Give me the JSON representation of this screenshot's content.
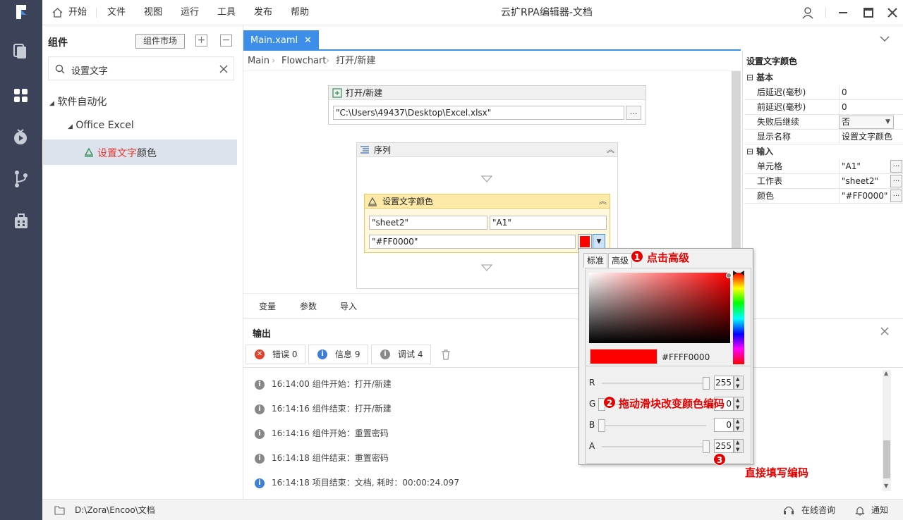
{
  "app": {
    "window_title": "云扩RPA编辑器-文档"
  },
  "menu": {
    "home": "开始",
    "file": "文件",
    "view": "视图",
    "run": "运行",
    "tools": "工具",
    "publish": "发布",
    "help": "帮助"
  },
  "left_panel": {
    "title": "组件",
    "market_button": "组件市场",
    "expand_button": "+",
    "collapse_button": "−",
    "search_value": "设置文字",
    "tree": [
      {
        "label": "软件自动化"
      },
      {
        "label": "Office Excel"
      },
      {
        "label_hit": "设置文字",
        "label_rest": "颜色"
      }
    ]
  },
  "tabs": [
    {
      "label": "Main.xaml",
      "close": "✕"
    }
  ],
  "breadcrumb": [
    "Main",
    "Flowchart",
    "打开/新建"
  ],
  "designer": {
    "open_activity": {
      "title": "打开/新建",
      "path": "\"C:\\Users\\49437\\Desktop\\Excel.xlsx\"",
      "browse": "..."
    },
    "sequence": {
      "title": "序列"
    },
    "set_color_activity": {
      "title": "设置文字颜色",
      "sheet": "\"sheet2\"",
      "cell": "\"A1\"",
      "color": "\"#FF0000\""
    }
  },
  "designer_tabs": [
    "变量",
    "参数",
    "导入"
  ],
  "properties": {
    "title": "设置文字颜色",
    "groups": [
      {
        "name": "基本",
        "rows": [
          {
            "key": "后延迟(毫秒)",
            "value": "0"
          },
          {
            "key": "前延迟(毫秒)",
            "value": "0"
          },
          {
            "key": "失败后继续",
            "value": "否"
          },
          {
            "key": "显示名称",
            "value": "设置文字颜色"
          }
        ]
      },
      {
        "name": "输入",
        "rows": [
          {
            "key": "单元格",
            "value": "\"A1\""
          },
          {
            "key": "工作表",
            "value": "\"sheet2\""
          },
          {
            "key": "颜色",
            "value": "\"#FF0000\""
          }
        ]
      }
    ]
  },
  "output": {
    "title": "输出",
    "filters": {
      "error": "错误 0",
      "info": "信息 9",
      "debug": "调试 4"
    },
    "logs": [
      {
        "text": "16:14:00 组件开始：打开/新建",
        "color": "#888888"
      },
      {
        "text": "16:14:16 组件结束：打开/新建",
        "color": "#888888"
      },
      {
        "text": "16:14:16 组件开始：重置密码",
        "color": "#888888"
      },
      {
        "text": "16:14:18 组件结束：重置密码",
        "color": "#888888"
      },
      {
        "text": "16:14:18 项目结束：文档, 耗时：00:00:24.097",
        "color": "#3d7fd6"
      }
    ]
  },
  "color_picker": {
    "tabs": [
      "标准",
      "高级"
    ],
    "hex": "#FFFF0000",
    "preview_color": "#ff0000",
    "sliders": [
      {
        "label": "R",
        "value": "255",
        "level": 1.0
      },
      {
        "label": "G",
        "value": "0",
        "level": 0.0
      },
      {
        "label": "B",
        "value": "0",
        "level": 0.0
      },
      {
        "label": "A",
        "value": "255",
        "level": 1.0
      }
    ]
  },
  "annotations": [
    {
      "num": "1",
      "text": "点击高级"
    },
    {
      "num": "2",
      "text": "拖动滑块改变颜色编码"
    },
    {
      "num": "3",
      "text": "直接填写编码"
    }
  ],
  "statusbar": {
    "path": "D:\\Zora\\Encoo\\文档",
    "consult": "在线咨询",
    "notify": "通知"
  },
  "colors": {
    "accent": "#3d8ee8",
    "rail": "#3c4257",
    "annotation": "#e60000",
    "highlight_match": "#e53935"
  }
}
